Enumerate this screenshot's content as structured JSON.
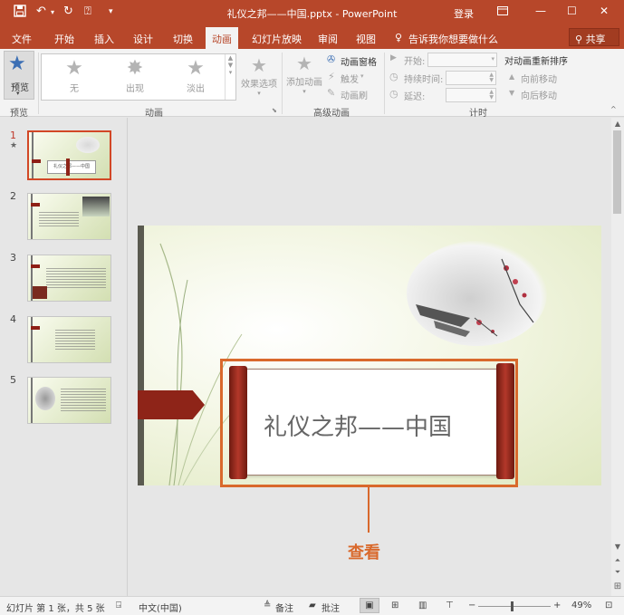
{
  "window": {
    "title": "礼仪之邦——中国.pptx  -  PowerPoint",
    "login": "登录",
    "accent": "#b7472a"
  },
  "tabs": {
    "file": "文件",
    "home": "开始",
    "insert": "插入",
    "design": "设计",
    "transitions": "切换",
    "animations": "动画",
    "slideshow": "幻灯片放映",
    "review": "审阅",
    "view": "视图",
    "tellme": "告诉我你想要做什么",
    "share": "共享"
  },
  "ribbon": {
    "preview": "预览",
    "preview_group": "预览",
    "gallery": [
      "无",
      "出现",
      "淡出"
    ],
    "effect_options": "效果选项",
    "animation_group": "动画",
    "add_animation": "添加动画",
    "animation_pane": "动画窗格",
    "trigger": "触发",
    "animation_painter": "动画刷",
    "advanced_group": "高级动画",
    "start": "开始:",
    "duration": "持续时间:",
    "delay": "延迟:",
    "timing_group": "计时",
    "reorder_title": "对动画重新排序",
    "move_earlier": "向前移动",
    "move_later": "向后移动"
  },
  "thumbnails": [
    {
      "number": "1",
      "star": "★"
    },
    {
      "number": "2"
    },
    {
      "number": "3"
    },
    {
      "number": "4"
    },
    {
      "number": "5"
    }
  ],
  "thumb1_title": "礼仪之邦——中国",
  "slide": {
    "title": "礼仪之邦——中国"
  },
  "callout": {
    "label": "查看",
    "color": "#d9692c"
  },
  "statusbar": {
    "slide_info": "幻灯片 第 1 张，共 5 张",
    "language": "中文(中国)",
    "notes": "备注",
    "comments": "批注",
    "zoom": "49%"
  }
}
